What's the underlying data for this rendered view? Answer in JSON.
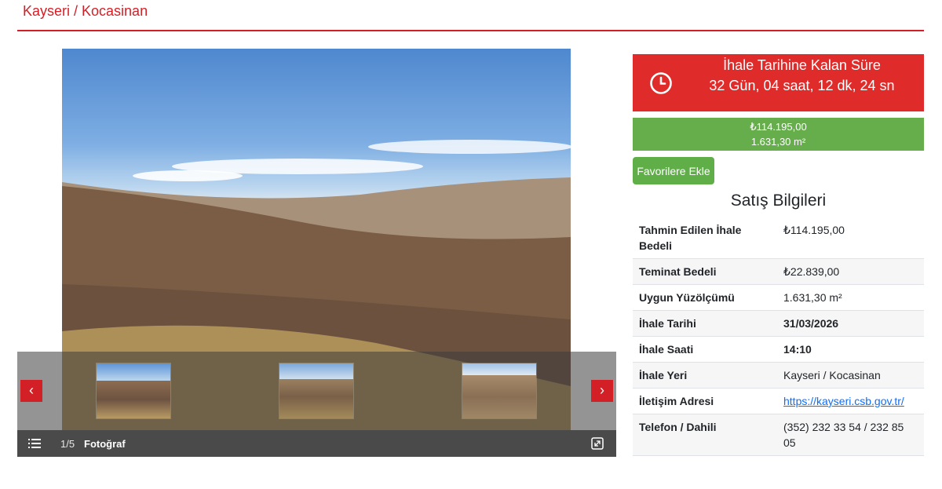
{
  "header": {
    "title": "Kayseri / Kocasinan"
  },
  "gallery": {
    "counter": "1/5",
    "label": "Fotoğraf",
    "prev_label": "‹",
    "next_label": "›"
  },
  "timer": {
    "title": "İhale Tarihine Kalan Süre",
    "value": "32 Gün, 04 saat, 12 dk, 24 sn"
  },
  "price": {
    "amount": "₺114.195,00",
    "area": "1.631,30 m²"
  },
  "favorite_button": "Favorilere Ekle",
  "section_title": "Satış Bilgileri",
  "info": [
    {
      "label": "Tahmin Edilen İhale Bedeli",
      "value": "₺114.195,00"
    },
    {
      "label": "Teminat Bedeli",
      "value": "₺22.839,00"
    },
    {
      "label": "Uygun Yüzölçümü",
      "value": "1.631,30 m²"
    },
    {
      "label": "İhale Tarihi",
      "value": "31/03/2026"
    },
    {
      "label": "İhale Saati",
      "value": "14:10"
    },
    {
      "label": "İhale Yeri",
      "value": "Kayseri / Kocasinan"
    },
    {
      "label": "İletişim Adresi",
      "value": "https://kayseri.csb.gov.tr/"
    },
    {
      "label": "Telefon / Dahili",
      "value": "(352) 232 33 54 / 232 85 05"
    }
  ],
  "colors": {
    "accent_red": "#d32026",
    "timer_red": "#e02b2b",
    "price_green": "#66ad4c",
    "link_blue": "#0d6efd"
  },
  "icons": [
    "clock-icon",
    "list-icon",
    "expand-icon",
    "chevron-left-icon",
    "chevron-right-icon"
  ]
}
